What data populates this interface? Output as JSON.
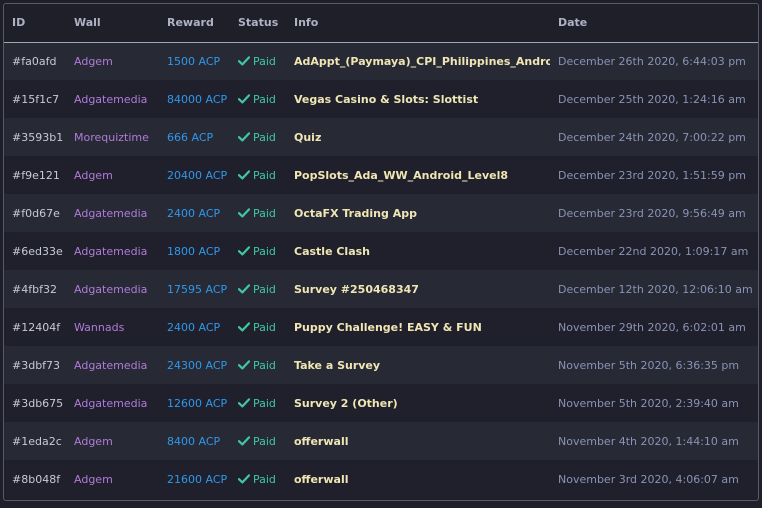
{
  "columns": {
    "id": "ID",
    "wall": "Wall",
    "reward": "Reward",
    "status": "Status",
    "info": "Info",
    "date": "Date"
  },
  "status_icon": "check-icon",
  "colors": {
    "wall": "#b07ad9",
    "reward": "#2f98ec",
    "status_paid": "#3fc9a3",
    "info": "#f0e6b4",
    "date": "#8a93b6"
  },
  "rows": [
    {
      "id": "#fa0afd",
      "wall": "Adgem",
      "reward": "1500 ACP",
      "status": "Paid",
      "info": "AdAppt_(Paymaya)_CPI_Philippines_Android",
      "date": "December 26th 2020, 6:44:03 pm"
    },
    {
      "id": "#15f1c7",
      "wall": "Adgatemedia",
      "reward": "84000 ACP",
      "status": "Paid",
      "info": "Vegas Casino & Slots: Slottist",
      "date": "December 25th 2020, 1:24:16 am"
    },
    {
      "id": "#3593b1",
      "wall": "Morequiztime",
      "reward": "666 ACP",
      "status": "Paid",
      "info": "Quiz",
      "date": "December 24th 2020, 7:00:22 pm"
    },
    {
      "id": "#f9e121",
      "wall": "Adgem",
      "reward": "20400 ACP",
      "status": "Paid",
      "info": "PopSlots_Ada_WW_Android_Level8",
      "date": "December 23rd 2020, 1:51:59 pm"
    },
    {
      "id": "#f0d67e",
      "wall": "Adgatemedia",
      "reward": "2400 ACP",
      "status": "Paid",
      "info": "OctaFX Trading App",
      "date": "December 23rd 2020, 9:56:49 am"
    },
    {
      "id": "#6ed33e",
      "wall": "Adgatemedia",
      "reward": "1800 ACP",
      "status": "Paid",
      "info": "Castle Clash",
      "date": "December 22nd 2020, 1:09:17 am"
    },
    {
      "id": "#4fbf32",
      "wall": "Adgatemedia",
      "reward": "17595 ACP",
      "status": "Paid",
      "info": "Survey #250468347",
      "date": "December 12th 2020, 12:06:10 am"
    },
    {
      "id": "#12404f",
      "wall": "Wannads",
      "reward": "2400 ACP",
      "status": "Paid",
      "info": "Puppy Challenge! EASY & FUN",
      "date": "November 29th 2020, 6:02:01 am"
    },
    {
      "id": "#3dbf73",
      "wall": "Adgatemedia",
      "reward": "24300 ACP",
      "status": "Paid",
      "info": "Take a Survey",
      "date": "November 5th 2020, 6:36:35 pm"
    },
    {
      "id": "#3db675",
      "wall": "Adgatemedia",
      "reward": "12600 ACP",
      "status": "Paid",
      "info": "Survey 2 (Other)",
      "date": "November 5th 2020, 2:39:40 am"
    },
    {
      "id": "#1eda2c",
      "wall": "Adgem",
      "reward": "8400 ACP",
      "status": "Paid",
      "info": "offerwall",
      "date": "November 4th 2020, 1:44:10 am"
    },
    {
      "id": "#8b048f",
      "wall": "Adgem",
      "reward": "21600 ACP",
      "status": "Paid",
      "info": "offerwall",
      "date": "November 3rd 2020, 4:06:07 am"
    }
  ]
}
